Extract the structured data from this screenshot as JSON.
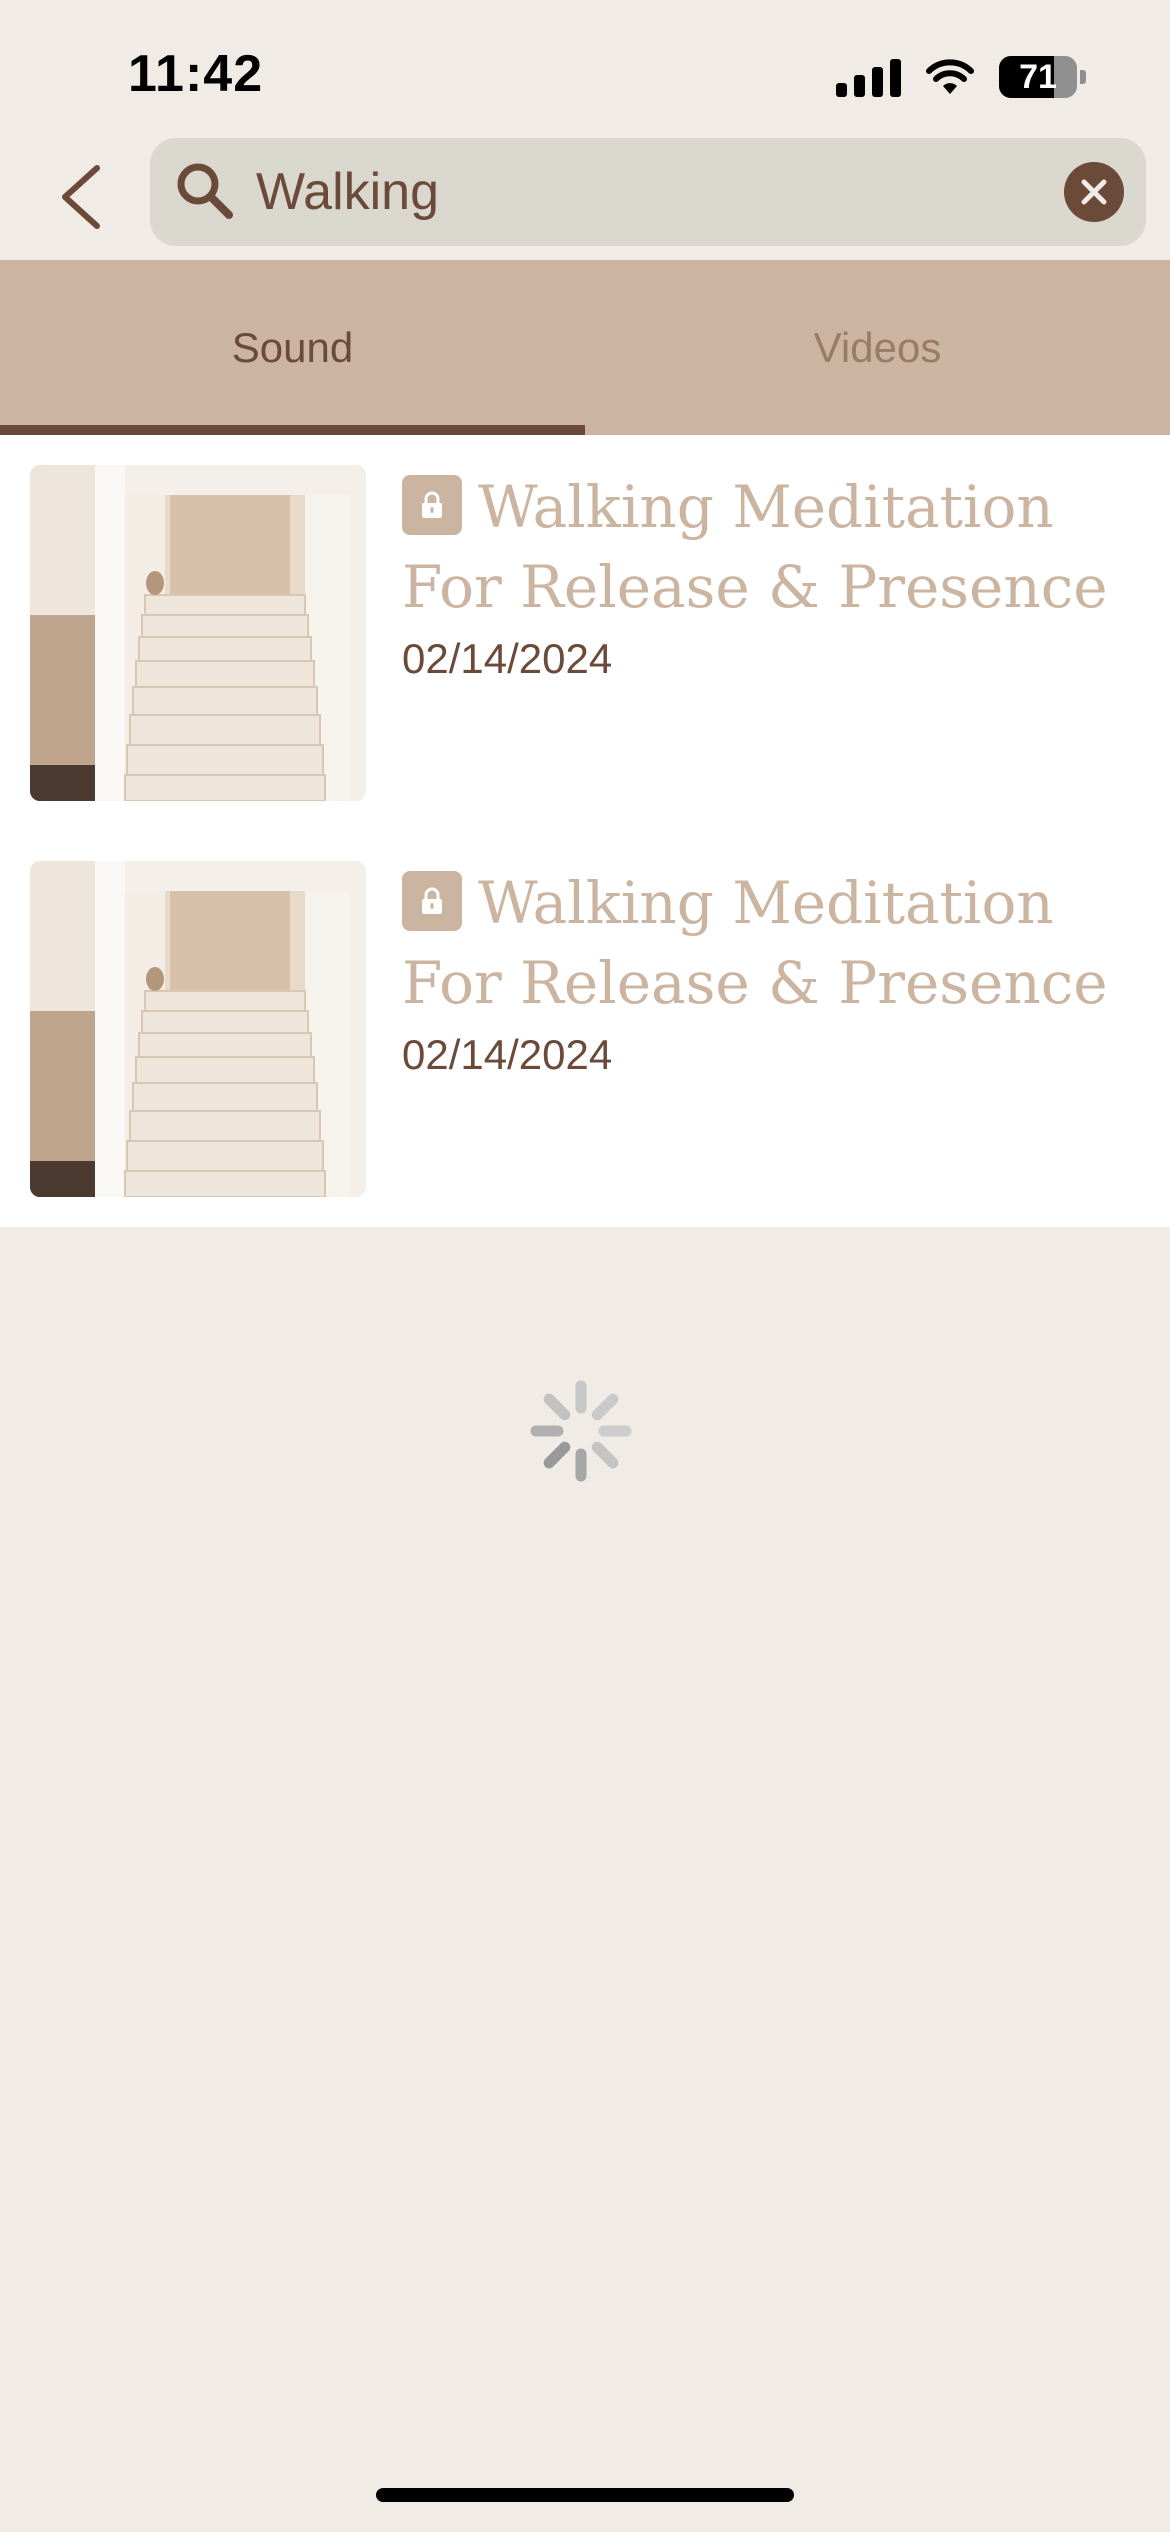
{
  "status_bar": {
    "time": "11:42",
    "battery": "71",
    "icons": [
      "cellular-signal-icon",
      "wifi-icon",
      "battery-icon"
    ]
  },
  "search": {
    "query": "Walking",
    "icons": [
      "back-chevron-icon",
      "search-icon",
      "clear-icon"
    ]
  },
  "tabs": [
    {
      "label": "Sound",
      "selected": true
    },
    {
      "label": "Videos",
      "selected": false
    }
  ],
  "results": [
    {
      "title": "Walking Meditation For Release & Presence",
      "date": "02/14/2024",
      "locked": true
    },
    {
      "title": "Walking Meditation For Release & Presence",
      "date": "02/14/2024",
      "locked": true
    }
  ],
  "colors": {
    "background": "#F0EBE4",
    "accent_brown": "#6B4A3A",
    "tab_bar": "#CBB5A0",
    "title_tan": "#CBB5A0",
    "search_field": "#DAD7CF"
  },
  "loading": true
}
